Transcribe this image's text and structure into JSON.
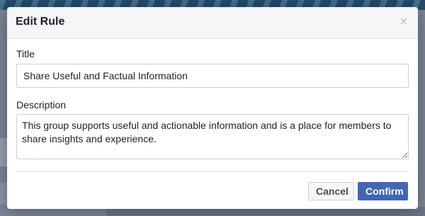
{
  "dialog": {
    "title": "Edit Rule",
    "close_icon": "×",
    "title_field": {
      "label": "Title",
      "value": "Share Useful and Factual Information"
    },
    "description_field": {
      "label": "Description",
      "value": "This group supports useful and actionable information and is a place for members to share insights and experience."
    },
    "buttons": {
      "cancel_label": "Cancel",
      "confirm_label": "Confirm"
    }
  },
  "colors": {
    "confirm_bg": "#4267b2",
    "header_bg": "#f5f6f7",
    "overlay": "#7c8698"
  },
  "icons": {
    "close": "close-icon"
  }
}
